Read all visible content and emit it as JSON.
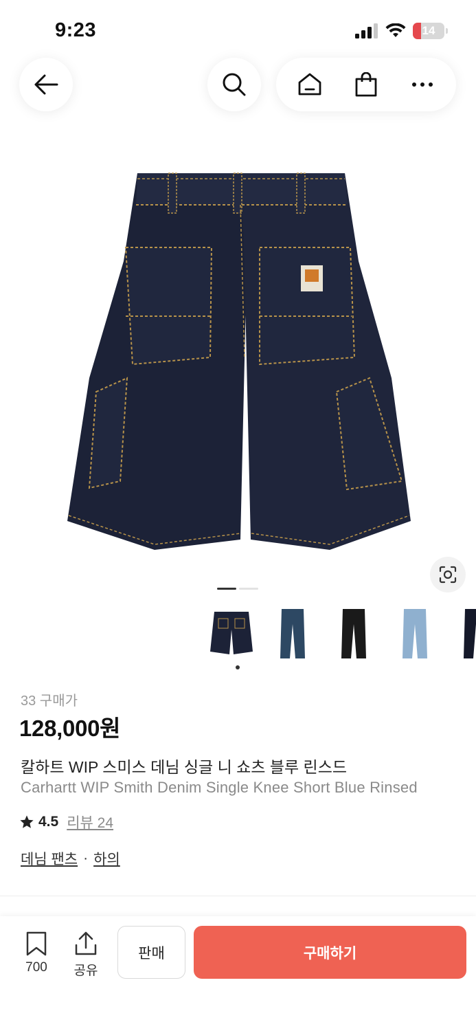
{
  "status_bar": {
    "time": "9:23",
    "battery_level": "14",
    "icons": [
      "cellular-signal-icon",
      "wifi-icon",
      "battery-icon"
    ]
  },
  "top_nav": {
    "icons": [
      "back-arrow-icon",
      "search-icon",
      "home-icon",
      "shopping-bag-icon",
      "more-icon"
    ]
  },
  "gallery": {
    "page_index": 1,
    "page_count": 2,
    "thumbnails": [
      "black denim shorts",
      "blue denim pants",
      "black pants",
      "light blue denim pants",
      "dark pants"
    ],
    "selected_thumbnail": 0
  },
  "product": {
    "purchase_count": "33 구매가",
    "price": "128,000원",
    "name_ko": "칼하트 WIP 스미스 데님 싱글 니 쇼츠 블루 린스드",
    "name_en": "Carhartt WIP Smith Denim Single Knee Short Blue Rinsed",
    "rating": "4.5",
    "review_label": "리뷰 24",
    "category_1": "데님 팬츠",
    "category_separator": "·",
    "category_2": "하의"
  },
  "bottom_bar": {
    "bookmark_count": "700",
    "share_label": "공유",
    "sell_label": "판매",
    "buy_label": "구매하기"
  },
  "colors": {
    "accent": "#ef6253",
    "denim": "#1c2237",
    "stitch": "#b8934a"
  }
}
